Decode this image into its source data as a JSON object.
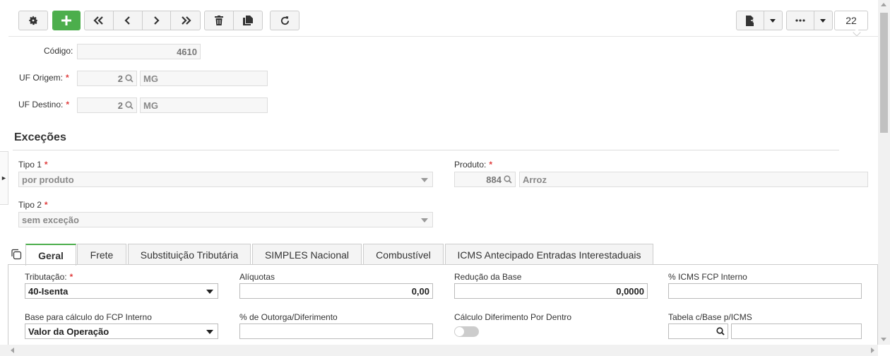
{
  "toolbar": {
    "count": "22",
    "icons": [
      "gear-icon",
      "plus-icon",
      "first-icon",
      "prev-icon",
      "next-icon",
      "last-icon",
      "trash-icon",
      "copy-icon",
      "refresh-icon",
      "export-file-icon",
      "more-icon"
    ]
  },
  "header": {
    "codigo_label": "Código:",
    "codigo_value": "4610",
    "uf_origem_label": "UF Origem:",
    "uf_origem_code": "2",
    "uf_origem_name": "MG",
    "uf_destino_label": "UF Destino:",
    "uf_destino_code": "2",
    "uf_destino_name": "MG",
    "required_mark": "*"
  },
  "excecoes": {
    "title": "Exceções",
    "tipo1_label": "Tipo 1",
    "tipo1_value": "por produto",
    "tipo2_label": "Tipo 2",
    "tipo2_value": "sem exceção",
    "produto_label": "Produto:",
    "produto_code": "884",
    "produto_name": "Arroz"
  },
  "tabs": [
    {
      "label": "Geral",
      "active": true
    },
    {
      "label": "Frete"
    },
    {
      "label": "Substituição Tributária"
    },
    {
      "label": "SIMPLES Nacional"
    },
    {
      "label": "Combustível"
    },
    {
      "label": "ICMS Antecipado Entradas Interestaduais"
    }
  ],
  "geral": {
    "tributacao_label": "Tributação:",
    "tributacao_value": "40-Isenta",
    "aliquotas_label": "Alíquotas",
    "aliquotas_value": "0,00",
    "reducao_label": "Redução da Base",
    "reducao_value": "0,0000",
    "fcp_interno_label": "% ICMS FCP Interno",
    "fcp_interno_value": "",
    "base_fcp_label": "Base para cálculo do FCP Interno",
    "base_fcp_value": "Valor da Operação",
    "outorga_label": "% de Outorga/Diferimento",
    "outorga_value": "",
    "calc_dif_label": "Cálculo Diferimento Por Dentro",
    "calc_dif_on": false,
    "tabela_label": "Tabela c/Base p/ICMS",
    "tabela_code": "",
    "tabela_name": ""
  },
  "colors": {
    "accent_green": "#4cae4c",
    "required_red": "#e03d3d"
  }
}
